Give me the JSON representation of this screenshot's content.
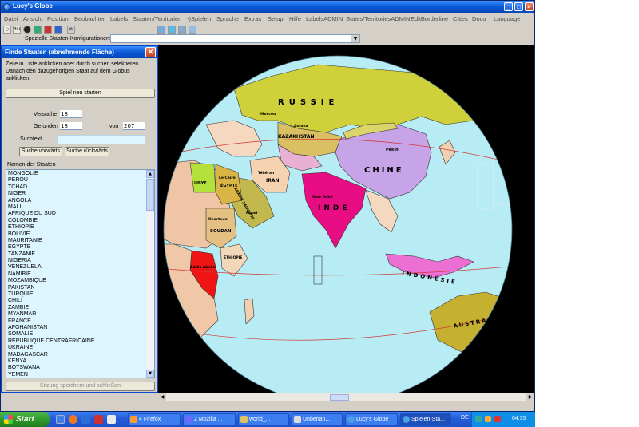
{
  "window": {
    "title": "Lucy's Globe"
  },
  "menu": [
    "Datei",
    "Ansicht",
    "Position",
    "Beobachter",
    "Labels",
    "Staaten/Territorien",
    "-)Spielen",
    "Sprache",
    "Extras",
    "Setup",
    "Hilfe",
    "LabelsADMIN",
    "States/TerritoriesADMIN",
    "EditBorderline",
    "Cities",
    "Docu",
    "Language"
  ],
  "toolbar": {
    "bla_label": "BLA"
  },
  "config": {
    "label": "Spezielle Staaten-Konfigurationen:",
    "value": "-"
  },
  "dialog": {
    "title": "Finde Staaten (abnehmende Fläche)",
    "instructions": [
      "Zeile in Liste anklicken oder durch suchen selektieren.",
      "Danach den  dazugehörigen Staat auf dem Globus",
      "anklicken."
    ],
    "restart_label": "Spiel neu starten",
    "attempts_label": "Versuche",
    "attempts_value": "18",
    "found_label": "Gefunden",
    "found_value": "18",
    "of_label": "von",
    "total_value": "207",
    "search_label": "Suchtext",
    "search_value": "",
    "search_forward_label": "Suche vorwärts",
    "search_back_label": "Suche rückwärts",
    "list_header": "Namen der Staaten",
    "states": [
      "MONGOLIE",
      "PÉROU",
      "TCHAD",
      "NIGER",
      "ANGOLA",
      "MALI",
      "AFRIQUE DU SUD",
      "COLOMBIE",
      "ÉTHIOPIE",
      "BOLIVIE",
      "MAURITANIE",
      "ÉGYPTE",
      "TANZANIE",
      "NIGÉRIA",
      "VENEZUELA",
      "NAMIBIE",
      "MOZAMBIQUE",
      "PAKISTAN",
      "TURQUIE",
      "CHILI",
      "ZAMBIE",
      "MYANMAR",
      "FRANCE",
      "AFGHANISTAN",
      "SOMALIE",
      "RÉPUBLIQUE CENTRAFRICAINE",
      "UKRAINE",
      "MADAGASCAR",
      "KENYA",
      "BOTSWANA",
      "YÉMEN"
    ],
    "save_label": "Sitzung speichern und schließen"
  },
  "map_labels": {
    "russia": "RUSSIE",
    "moscow": "Moscou",
    "astana": "Astana",
    "kazakhstan": "KAZAKHSTAN",
    "china": "CHINE",
    "beijing": "Pékin",
    "india": "INDE",
    "new_delhi": "New Dehli",
    "iran": "IRAN",
    "tehran": "Téhéran",
    "saudi": "ARABIE SAOUDITE",
    "riyadh": "Riyad",
    "egypt": "ÉGYPTE",
    "cairo": "Le Caire",
    "libya": "LIBYE",
    "sudan": "SOUDAN",
    "khartoum": "Khartoum",
    "ethiopia": "ÉTHIOPIE",
    "addis": "Addis Abeba",
    "indonesia": "INDONÉSIE",
    "australia": "AUSTRALIE"
  },
  "taskbar": {
    "start_label": "Start",
    "tasks": [
      "4 Firefox",
      "2 Mozilla ...",
      "world_...",
      "Unbenan...",
      "Lucy's Globe",
      "Spielen-Sta..."
    ],
    "lang": "DE",
    "clock": "04:35"
  }
}
